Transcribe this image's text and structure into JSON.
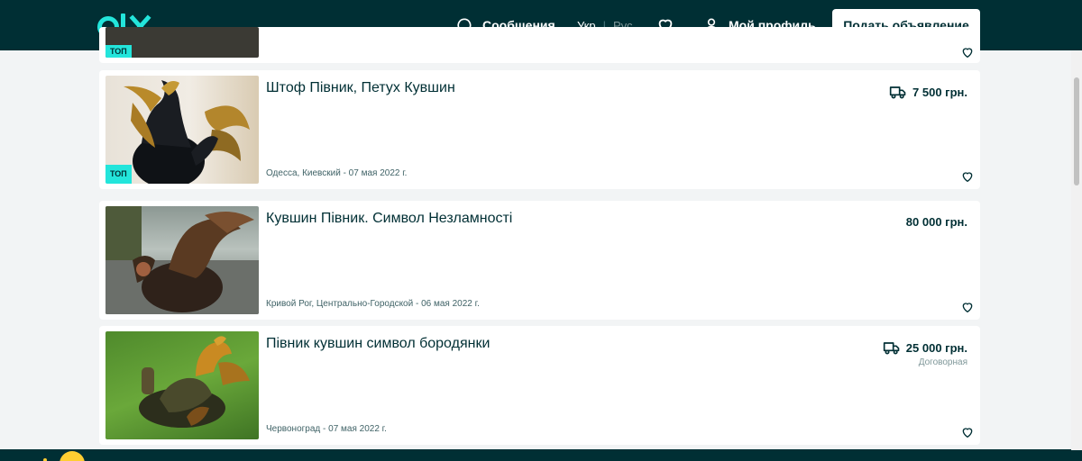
{
  "header": {
    "messages_label": "Сообщения",
    "lang_active": "Укр",
    "lang_separator": "|",
    "lang_inactive": "Рус",
    "profile_label": "Мой профиль",
    "post_button_label": "Подать объявление"
  },
  "listings": [
    {
      "partial": true,
      "badge": "ТОП"
    },
    {
      "title": "Штоф Півник, Петух Кувшин",
      "location_date": "Одесса, Киевский - 07 мая 2022 г.",
      "price": "7 500 грн.",
      "delivery": true,
      "badge": "ТОП"
    },
    {
      "title": "Кувшин Півник. Символ Незламності",
      "location_date": "Кривой Рог, Центрально-Городской - 06 мая 2022 г.",
      "price": "80 000 грн.",
      "delivery": false
    },
    {
      "title": "Півник кувшин символ бородянки",
      "location_date": "Червоноград - 07 мая 2022 г.",
      "price": "25 000 грн.",
      "negotiable": "Договорная",
      "delivery": true
    }
  ],
  "colors": {
    "brand_dark": "#002f34",
    "accent": "#23e5db",
    "page_bg": "#f2f4f5"
  },
  "icons": [
    "olx-logo",
    "chat-icon",
    "heart-icon",
    "user-icon",
    "truck-icon"
  ]
}
